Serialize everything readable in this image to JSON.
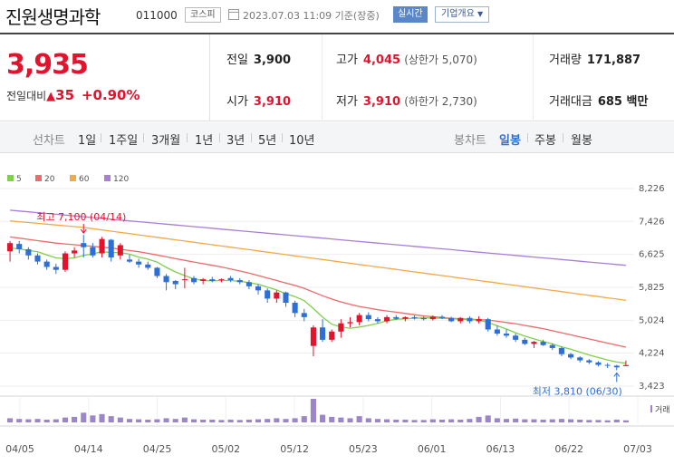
{
  "header": {
    "name": "진원생명과학",
    "code": "011000",
    "market": "코스피",
    "timestamp": "2023.07.03 11:09 기준(장중)",
    "realtime_label": "실시간",
    "overview_label": "기업개요"
  },
  "quote": {
    "price": "3,935",
    "change_label": "전일대비",
    "change": "35",
    "change_pct": "+0.90%",
    "prev_close_label": "전일",
    "prev_close": "3,900",
    "high_label": "고가",
    "high": "4,045",
    "upper_limit": "(상한가 5,070)",
    "volume_label": "거래량",
    "volume": "171,887",
    "open_label": "시가",
    "open": "3,910",
    "low_label": "저가",
    "low": "3,910",
    "lower_limit": "(하한가 2,730)",
    "turnover_label": "거래대금",
    "turnover": "685 백만"
  },
  "period_bar": {
    "line_label": "선차트",
    "line_periods": [
      "1일",
      "1주일",
      "3개월",
      "1년",
      "3년",
      "5년",
      "10년"
    ],
    "candle_label": "봉차트",
    "candle_periods": [
      "일봉",
      "주봉",
      "월봉"
    ],
    "active_candle": "일봉"
  },
  "colors": {
    "up": "#e2142d",
    "down": "#2c6fd6",
    "ma5": "#7fd04a",
    "ma20": "#ec6a6a",
    "ma60": "#f2a94a",
    "ma120": "#a87ed8",
    "volume": "#9b86c9"
  },
  "chart_data": {
    "type": "candlestick",
    "legend": [
      "5",
      "20",
      "60",
      "120"
    ],
    "y_ticks": [
      "8,226",
      "7,426",
      "6,625",
      "5,825",
      "5,024",
      "4,224",
      "3,423"
    ],
    "y_tick_values": [
      8226,
      7426,
      6625,
      5825,
      5024,
      4224,
      3423
    ],
    "ylim": [
      3423,
      8226
    ],
    "x_labels": [
      "04/05",
      "04/14",
      "04/25",
      "05/02",
      "05/12",
      "05/23",
      "06/01",
      "06/13",
      "06/22",
      "07/03"
    ],
    "volume_label": "거래",
    "annotations": {
      "high": {
        "text": "최고 7,100 (04/14)",
        "value": 7100,
        "date": "04/14"
      },
      "low": {
        "text": "최저 3,810 (06/30)",
        "value": 3810,
        "date": "06/30"
      }
    },
    "candles": [
      [
        6700,
        6950,
        6450,
        6900
      ],
      [
        6880,
        6950,
        6650,
        6750
      ],
      [
        6750,
        6800,
        6500,
        6600
      ],
      [
        6600,
        6650,
        6380,
        6450
      ],
      [
        6450,
        6500,
        6250,
        6320
      ],
      [
        6320,
        6400,
        6150,
        6250
      ],
      [
        6250,
        6700,
        6200,
        6650
      ],
      [
        6650,
        6800,
        6550,
        6720
      ],
      [
        6900,
        7100,
        6550,
        6800
      ],
      [
        6800,
        6900,
        6550,
        6600
      ],
      [
        6650,
        7050,
        6550,
        7000
      ],
      [
        6980,
        7000,
        6450,
        6550
      ],
      [
        6600,
        6900,
        6500,
        6850
      ],
      [
        6500,
        6620,
        6420,
        6450
      ],
      [
        6450,
        6520,
        6300,
        6380
      ],
      [
        6380,
        6450,
        6250,
        6300
      ],
      [
        6300,
        6320,
        6050,
        6100
      ],
      [
        6100,
        6150,
        5750,
        5950
      ],
      [
        5980,
        6000,
        5780,
        5900
      ],
      [
        6000,
        6300,
        5800,
        6020
      ],
      [
        6050,
        6100,
        5900,
        5950
      ],
      [
        5980,
        6050,
        5900,
        6020
      ],
      [
        6020,
        6080,
        5950,
        5980
      ],
      [
        6000,
        6040,
        5950,
        6020
      ],
      [
        6050,
        6100,
        5950,
        6000
      ],
      [
        6000,
        6050,
        5900,
        5950
      ],
      [
        5950,
        6000,
        5780,
        5850
      ],
      [
        5850,
        5900,
        5650,
        5750
      ],
      [
        5750,
        5800,
        5450,
        5550
      ],
      [
        5550,
        5750,
        5450,
        5700
      ],
      [
        5700,
        5720,
        5350,
        5450
      ],
      [
        5450,
        5500,
        5100,
        5200
      ],
      [
        5200,
        5300,
        5000,
        5100
      ],
      [
        4400,
        4900,
        4150,
        4850
      ],
      [
        4850,
        5050,
        4500,
        4550
      ],
      [
        4550,
        4800,
        4500,
        4750
      ],
      [
        4750,
        5050,
        4600,
        4950
      ],
      [
        4950,
        5100,
        4850,
        4980
      ],
      [
        4980,
        5200,
        4900,
        5150
      ],
      [
        5150,
        5220,
        5000,
        5050
      ],
      [
        5050,
        5100,
        4950,
        5000
      ],
      [
        5000,
        5150,
        4950,
        5100
      ],
      [
        5100,
        5150,
        5030,
        5060
      ],
      [
        5060,
        5120,
        5000,
        5100
      ],
      [
        5100,
        5140,
        5040,
        5080
      ],
      [
        5080,
        5120,
        5020,
        5050
      ],
      [
        5050,
        5140,
        5020,
        5110
      ],
      [
        5110,
        5150,
        5050,
        5080
      ],
      [
        5080,
        5110,
        4980,
        5000
      ],
      [
        5000,
        5100,
        4950,
        5080
      ],
      [
        5080,
        5120,
        4950,
        5000
      ],
      [
        5000,
        5120,
        4950,
        5050
      ],
      [
        5050,
        5080,
        4750,
        4800
      ],
      [
        4800,
        4900,
        4650,
        4700
      ],
      [
        4700,
        4800,
        4600,
        4650
      ],
      [
        4650,
        4700,
        4500,
        4550
      ],
      [
        4550,
        4600,
        4420,
        4450
      ],
      [
        4450,
        4520,
        4350,
        4500
      ],
      [
        4500,
        4550,
        4400,
        4420
      ],
      [
        4420,
        4460,
        4300,
        4350
      ],
      [
        4350,
        4380,
        4150,
        4200
      ],
      [
        4200,
        4230,
        4080,
        4120
      ],
      [
        4120,
        4150,
        4000,
        4050
      ],
      [
        4050,
        4080,
        3960,
        4000
      ],
      [
        4000,
        4030,
        3900,
        3940
      ],
      [
        3940,
        3980,
        3860,
        3920
      ],
      [
        3920,
        3940,
        3810,
        3880
      ],
      [
        3910,
        4045,
        3910,
        3935
      ]
    ],
    "ma5": [
      6780,
      6760,
      6720,
      6690,
      6610,
      6540,
      6520,
      6540,
      6600,
      6640,
      6690,
      6670,
      6670,
      6630,
      6560,
      6510,
      6440,
      6310,
      6200,
      6110,
      6030,
      5990,
      5980,
      5990,
      5990,
      5970,
      5940,
      5900,
      5830,
      5760,
      5670,
      5600,
      5500,
      5310,
      5100,
      4930,
      4860,
      4830,
      4860,
      4900,
      4950,
      5010,
      5050,
      5060,
      5070,
      5080,
      5080,
      5070,
      5060,
      5050,
      5040,
      5030,
      4970,
      4890,
      4810,
      4720,
      4640,
      4570,
      4510,
      4450,
      4380,
      4320,
      4250,
      4180,
      4120,
      4060,
      4010,
      3980
    ],
    "ma20": [
      7050,
      7020,
      6990,
      6960,
      6930,
      6900,
      6880,
      6860,
      6840,
      6820,
      6800,
      6780,
      6750,
      6720,
      6690,
      6650,
      6610,
      6570,
      6520,
      6480,
      6440,
      6400,
      6360,
      6320,
      6270,
      6220,
      6170,
      6110,
      6050,
      5990,
      5930,
      5870,
      5800,
      5710,
      5620,
      5540,
      5470,
      5410,
      5360,
      5320,
      5280,
      5250,
      5220,
      5190,
      5160,
      5130,
      5110,
      5090,
      5070,
      5060,
      5050,
      5040,
      5030,
      5000,
      4970,
      4940,
      4900,
      4860,
      4820,
      4770,
      4720,
      4670,
      4620,
      4570,
      4520,
      4470,
      4420,
      4370
    ],
    "ma60": [
      7440,
      7420,
      7400,
      7380,
      7360,
      7340,
      7320,
      7300,
      7280,
      7250,
      7220,
      7190,
      7160,
      7130,
      7100,
      7070,
      7040,
      7010,
      6980,
      6950,
      6920,
      6890,
      6860,
      6830,
      6800,
      6770,
      6740,
      6710,
      6680,
      6650,
      6620,
      6590,
      6560,
      6530,
      6500,
      6470,
      6440,
      6410,
      6380,
      6350,
      6320,
      6290,
      6260,
      6230,
      6200,
      6170,
      6140,
      6110,
      6080,
      6050,
      6020,
      5990,
      5960,
      5930,
      5900,
      5870,
      5840,
      5810,
      5780,
      5750,
      5720,
      5690,
      5660,
      5630,
      5600,
      5570,
      5540,
      5510
    ],
    "ma120": [
      7700,
      7680,
      7660,
      7640,
      7620,
      7600,
      7580,
      7560,
      7540,
      7520,
      7500,
      7480,
      7460,
      7440,
      7420,
      7400,
      7380,
      7360,
      7340,
      7320,
      7300,
      7280,
      7260,
      7240,
      7220,
      7200,
      7180,
      7160,
      7140,
      7120,
      7100,
      7080,
      7060,
      7040,
      7020,
      7000,
      6980,
      6960,
      6940,
      6920,
      6900,
      6880,
      6860,
      6840,
      6820,
      6800,
      6780,
      6760,
      6740,
      6720,
      6700,
      6680,
      6660,
      6640,
      6620,
      6600,
      6580,
      6560,
      6540,
      6520,
      6500,
      6480,
      6460,
      6440,
      6420,
      6400,
      6380,
      6360
    ],
    "volumes": [
      12,
      10,
      9,
      10,
      8,
      9,
      14,
      16,
      28,
      20,
      24,
      18,
      14,
      10,
      9,
      8,
      9,
      12,
      10,
      14,
      9,
      8,
      8,
      7,
      8,
      7,
      8,
      9,
      10,
      12,
      10,
      12,
      18,
      68,
      22,
      16,
      14,
      12,
      18,
      12,
      10,
      9,
      8,
      8,
      7,
      7,
      9,
      8,
      9,
      8,
      10,
      16,
      20,
      12,
      10,
      11,
      9,
      9,
      8,
      9,
      10,
      9,
      8,
      7,
      7,
      6,
      8,
      6
    ]
  }
}
